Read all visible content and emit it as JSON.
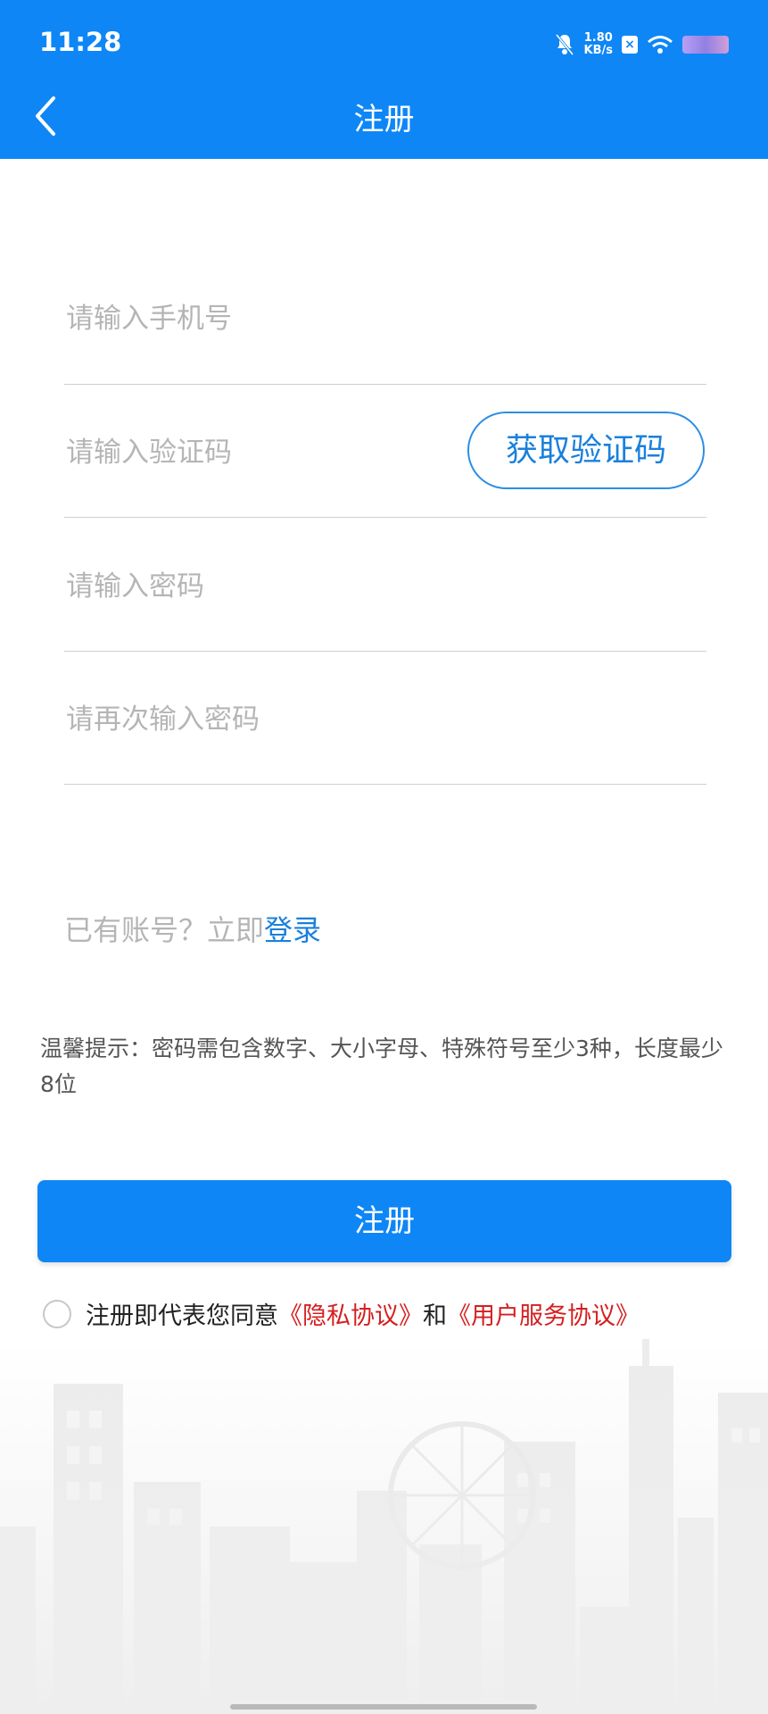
{
  "status_bar": {
    "time": "11:28",
    "speed_value": "1.80",
    "speed_unit": "KB/s"
  },
  "header": {
    "title": "注册"
  },
  "form": {
    "phone_placeholder": "请输入手机号",
    "code_placeholder": "请输入验证码",
    "get_code_label": "获取验证码",
    "password_placeholder": "请输入密码",
    "confirm_placeholder": "请再次输入密码"
  },
  "login": {
    "prefix": "已有账号？立即",
    "link": "登录"
  },
  "tip": "温馨提示：密码需包含数字、大小字母、特殊符号至少3种，长度最少8位",
  "submit_label": "注册",
  "agreement": {
    "prefix": "注册即代表您同意",
    "privacy": "《隐私协议》",
    "and": "和",
    "service": "《用户服务协议》"
  },
  "colors": {
    "primary": "#0e86f6",
    "link": "#1a80dc",
    "warning": "#d51f1f"
  }
}
